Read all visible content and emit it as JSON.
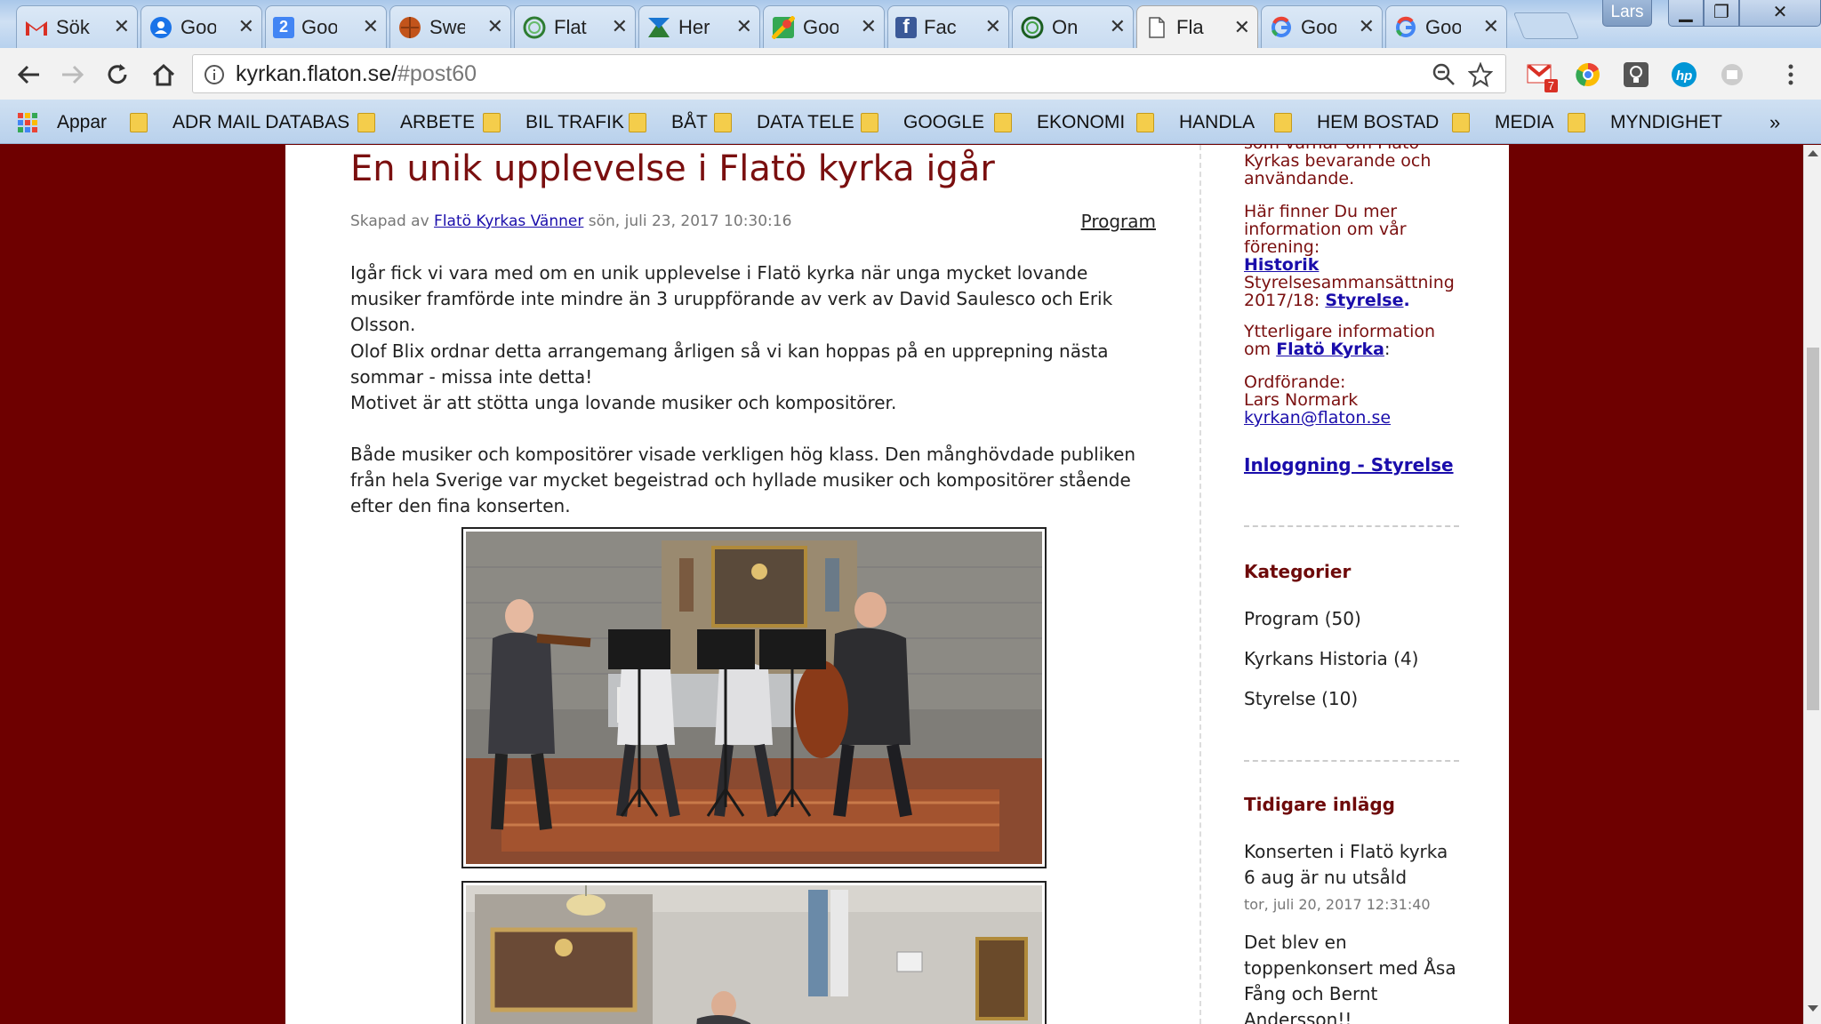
{
  "browser": {
    "tabs": [
      {
        "title": "Sök",
        "icon": "gmail-icon",
        "active": false
      },
      {
        "title": "Goo",
        "icon": "google-contacts-icon",
        "active": false
      },
      {
        "title": "Goo",
        "icon": "google-calendar-icon",
        "active": false
      },
      {
        "title": "Swe",
        "icon": "globe-icon",
        "active": false
      },
      {
        "title": "Flat",
        "icon": "flaton-icon",
        "active": false
      },
      {
        "title": "Her",
        "icon": "here-maps-icon",
        "active": false
      },
      {
        "title": "Goo",
        "icon": "google-maps-icon",
        "active": false
      },
      {
        "title": "Fac",
        "icon": "facebook-icon",
        "active": false
      },
      {
        "title": "On",
        "icon": "flaton-icon",
        "active": false
      },
      {
        "title": "Fla",
        "icon": "document-icon",
        "active": true
      },
      {
        "title": "Goo",
        "icon": "google-icon",
        "active": false
      },
      {
        "title": "Goo",
        "icon": "google-icon",
        "active": false
      }
    ],
    "calendar_day": "2",
    "profile_name": "Lars",
    "url_host": "kyrkan.flaton.se/",
    "url_hash": "#post60",
    "gmail_badge": "7",
    "bookmarks": {
      "apps_label": "Appar",
      "folders": [
        "ADR MAIL DATABAS",
        "ARBETE",
        "BIL TRAFIK",
        "BÅT",
        "DATA TELE",
        "GOOGLE",
        "EKONOMI",
        "HANDLA",
        "HEM BOSTAD",
        "MEDIA",
        "MYNDIGHET"
      ],
      "overflow": "»"
    }
  },
  "post": {
    "title": "En unik upplevelse i Flatö kyrka igår",
    "meta_prefix": "Skapad av",
    "author": "Flatö Kyrkas Vänner",
    "date": "sön, juli 23, 2017 10:30:16",
    "category": "Program",
    "paragraphs": [
      "Igår fick vi vara med om en unik upplevelse i Flatö kyrka när unga mycket lovande musiker framförde inte mindre än 3 uruppförande av verk av David Saulesco och Erik Olsson.",
      "Olof Blix ordnar detta arrangemang årligen så vi kan hoppas på en upprepning nästa sommar - missa inte detta!",
      "Motivet är att stötta unga lovande musiker och kompositörer.",
      "Både musiker och kompositörer visade verkligen hög klass. Den månghövdade publiken från hela Sverige var mycket begeistrad och hyllade musiker och kompositörer stående efter den fina konserten."
    ]
  },
  "sidebar": {
    "intro_cut": "som värnar om Flatö",
    "intro_rest_1": "Kyrkas bevarande och",
    "intro_rest_2": "användande.",
    "info_1": "Här finner Du mer",
    "info_2": "information om vår",
    "info_3": "förening:",
    "historik_link": "Historik",
    "board_text_1": "Styrelsesammansättning",
    "board_text_2": "2017/18:",
    "board_link": "Styrelse",
    "board_period": ".",
    "more_info_1": "Ytterligare information",
    "more_info_2": "om",
    "church_link": "Flatö Kyrka",
    "colon": ":",
    "chair_label": "Ordförande:",
    "chair_name": "Lars Normark",
    "chair_email": "kyrkan@flaton.se",
    "login_link": "Inloggning - Styrelse",
    "categories_heading": "Kategorier",
    "categories": [
      "Program (50)",
      "Kyrkans Historia (4)",
      "Styrelse (10)"
    ],
    "earlier_heading": "Tidigare inlägg",
    "earlier_posts": [
      {
        "title_1": "Konserten i Flatö kyrka",
        "title_2": "6 aug är nu utsåld",
        "date": "tor, juli 20, 2017 12:31:40"
      },
      {
        "title_1": "Det blev en",
        "title_2": "toppenkonsert med Åsa",
        "title_3": "Fång och Bernt",
        "title_4": "Andersson!!"
      }
    ]
  },
  "colors": {
    "page_background": "#6e0000",
    "title_color": "#7a0f0f",
    "link_color": "#1a0dab"
  }
}
